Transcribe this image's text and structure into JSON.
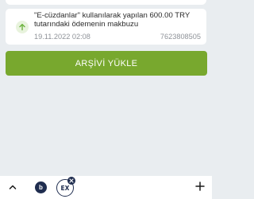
{
  "transaction": {
    "title": "\"E-cüzdanlar\" kullanılarak yapılan 600.00 TRY tutarındaki ödemenin makbuzu",
    "date": "19.11.2022 02:08",
    "number": "7623808505",
    "icon": "arrow-up-icon",
    "icon_color": "#6cb33f"
  },
  "archive_button": {
    "label": "ARŞİVİ YÜKLE",
    "color": "#78a82e"
  },
  "bottom_bar": {
    "left_icon": "caret-up-icon",
    "circle_letter": "b",
    "app_icon": "app-icon",
    "app_glyph": "EX",
    "right_icon": "plus-icon",
    "accent_color": "#1f2d4f"
  }
}
